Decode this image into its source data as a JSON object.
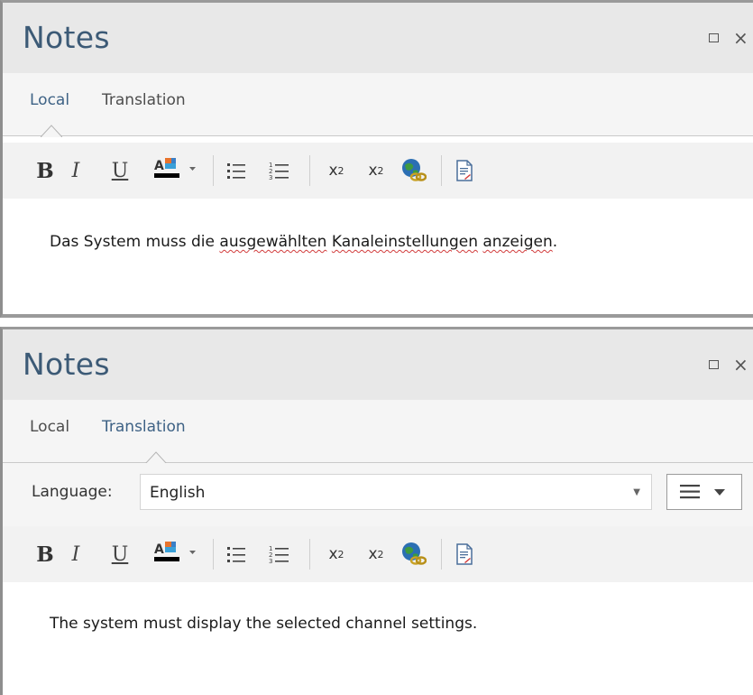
{
  "panels": [
    {
      "title": "Notes",
      "tabs": [
        "Local",
        "Translation"
      ],
      "active_tab": "Local",
      "text_parts": [
        "Das System muss die ",
        "ausgewählten",
        " ",
        "Kanaleinstellungen",
        " ",
        "anzeigen",
        "."
      ]
    },
    {
      "title": "Notes",
      "tabs": [
        "Local",
        "Translation"
      ],
      "active_tab": "Translation",
      "language_label": "Language:",
      "language_value": "English",
      "text": "The system must display the selected channel settings."
    }
  ],
  "toolbar": {
    "bold": "B",
    "italic": "I",
    "underline": "U",
    "superscript_base": "x",
    "superscript_exp": "2",
    "subscript_base": "x",
    "subscript_exp": "2"
  },
  "icons": {
    "maximize": "square",
    "close": "×",
    "font_color": "font-color-icon",
    "bullets": "bullet-list-icon",
    "numbers": "numbered-list-icon",
    "hyperlink": "globe-link-icon",
    "document": "document-icon"
  },
  "colors": {
    "title": "#3c5a76",
    "active_tab": "#3e6285",
    "font_color_bar": "#000000"
  }
}
